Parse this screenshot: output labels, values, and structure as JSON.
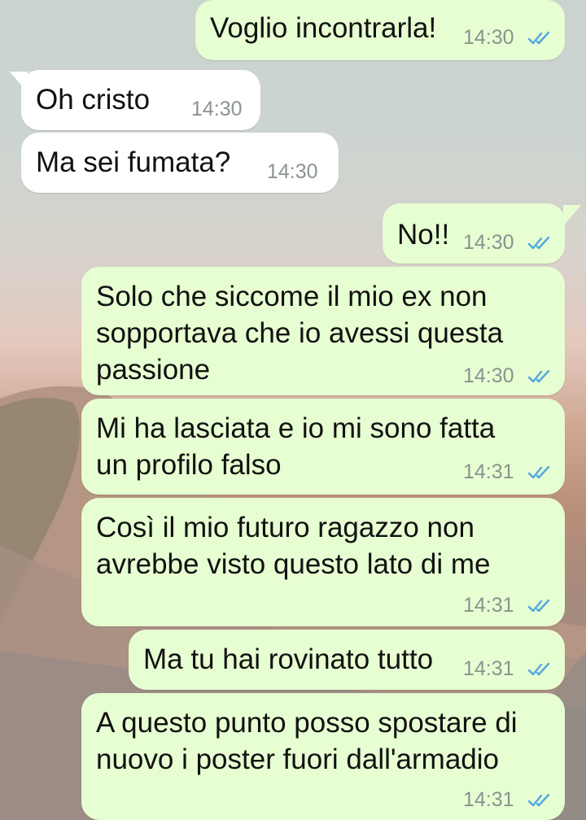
{
  "chat": {
    "messages": [
      {
        "side": "outgoing",
        "text": "Voglio incontrarla!",
        "time": "14:30",
        "status": "read-icon"
      },
      {
        "side": "incoming",
        "text": "Oh cristo",
        "time": "14:30"
      },
      {
        "side": "incoming",
        "text": "Ma sei fumata?",
        "time": "14:30"
      },
      {
        "side": "outgoing",
        "text": "No!!",
        "time": "14:30",
        "status": "read-icon"
      },
      {
        "side": "outgoing",
        "text": "Solo che siccome il mio ex non\nsopportava che io avessi questa\npassione",
        "time": "14:30",
        "status": "read-icon"
      },
      {
        "side": "outgoing",
        "text": "Mi ha lasciata e io mi sono fatta\nun profilo falso",
        "time": "14:31",
        "status": "read-icon"
      },
      {
        "side": "outgoing",
        "text": "Così il mio futuro ragazzo non\navrebbe visto questo lato di me",
        "time": "14:31",
        "status": "read-icon"
      },
      {
        "side": "outgoing",
        "text": "Ma tu hai rovinato tutto",
        "time": "14:31",
        "status": "read-icon"
      },
      {
        "side": "outgoing",
        "text": "A questo punto posso spostare di\nnuovo i poster fuori dall'armadio",
        "time": "14:31",
        "status": "read-icon"
      }
    ]
  },
  "colors": {
    "outgoing_bubble": "#e7fed2",
    "incoming_bubble": "#ffffff",
    "read_ticks": "#4fa8e0",
    "timestamp": "#8a938c"
  }
}
